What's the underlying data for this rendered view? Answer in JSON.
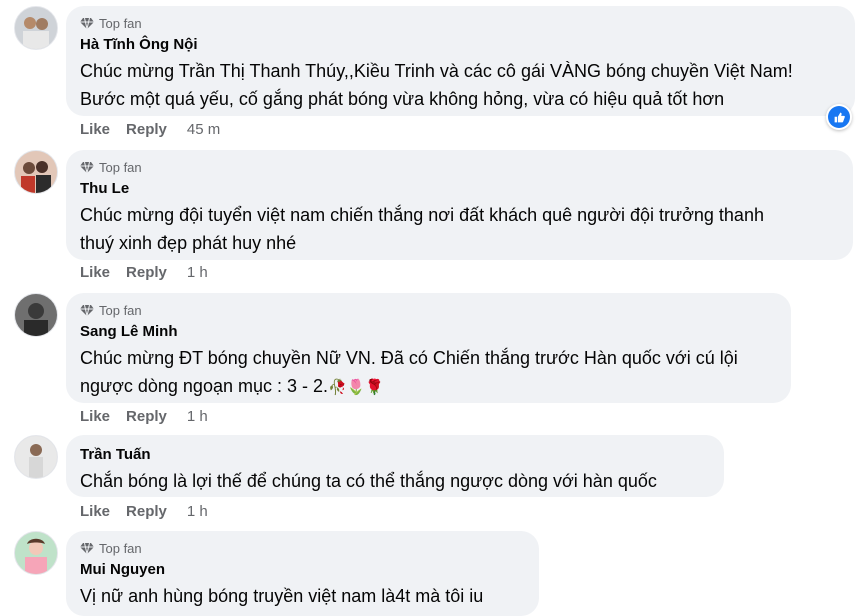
{
  "badge_label": "Top fan",
  "accent_color": "#1877f2",
  "comments": [
    {
      "top_fan": true,
      "name": "Hà Tĩnh Ông Nội",
      "lines": [
        "Chúc mừng Trần Thị Thanh Thúy,,Kiều Trinh và các cô gái VÀNG bóng chuyền Việt Nam!",
        "Bước một quá yếu, cố gắng phát bóng vừa không hỏng, vừa có hiệu quả tốt hơn"
      ],
      "like": "Like",
      "reply": "Reply",
      "time": "45 m",
      "reaction": "like-icon"
    },
    {
      "top_fan": true,
      "name": "Thu Le",
      "lines": [
        "Chúc mừng đội tuyển việt nam chiến thắng nơi đất khách quê người đội trưởng thanh",
        "thuý xinh đẹp phát huy nhé"
      ],
      "like": "Like",
      "reply": "Reply",
      "time": "1 h"
    },
    {
      "top_fan": true,
      "name": "Sang Lê Minh",
      "lines": [
        "Chúc mừng ĐT bóng chuyền Nữ VN. Đã có Chiến thắng trước Hàn quốc với cú lội",
        "ngược dòng ngoạn mục : 3 - 2."
      ],
      "emojis": "🥀🌷🌹",
      "like": "Like",
      "reply": "Reply",
      "time": "1 h"
    },
    {
      "top_fan": false,
      "name": "Trần Tuấn",
      "lines": [
        "Chắn bóng là lợi thế để chúng ta có thể thắng ngược dòng với hàn quốc"
      ],
      "like": "Like",
      "reply": "Reply",
      "time": "1 h"
    },
    {
      "top_fan": true,
      "name": "Mui Nguyen",
      "lines": [
        "Vị nữ anh hùng bóng truyền việt nam là4t mà tôi iu"
      ]
    }
  ]
}
